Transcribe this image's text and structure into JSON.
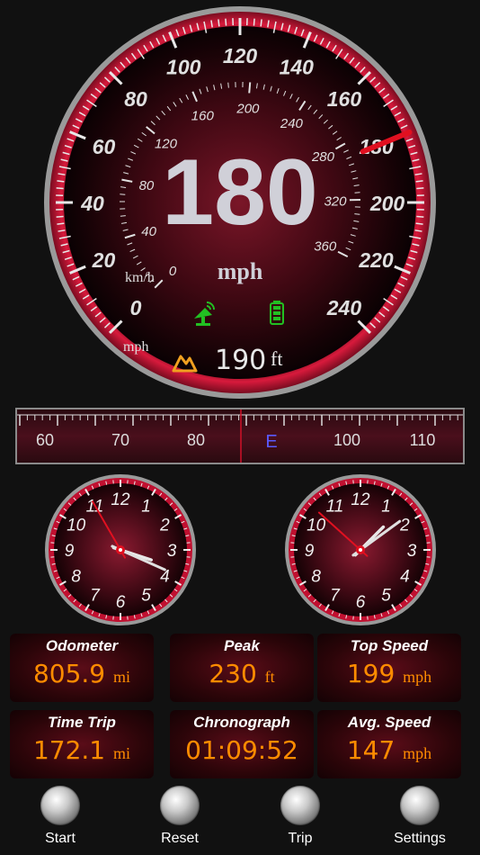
{
  "speedometer": {
    "speed": "180",
    "unit": "mph",
    "needle_value_mph": 180,
    "outer_ticks": [
      "0",
      "20",
      "40",
      "60",
      "80",
      "100",
      "120",
      "140",
      "160",
      "180",
      "200",
      "220",
      "240"
    ],
    "outer_unit": "mph",
    "inner_ticks": [
      "0",
      "40",
      "80",
      "120",
      "160",
      "200",
      "240",
      "280",
      "320",
      "360"
    ],
    "inner_unit": "km/h",
    "altitude_value": "190",
    "altitude_unit": "ft",
    "colors": {
      "accent": "#cc1030",
      "needle": "#e01020",
      "gps": "#22c022",
      "battery": "#22c022",
      "altitude_icon": "#f0a020"
    }
  },
  "compass": {
    "labels": [
      "60",
      "70",
      "80",
      "E",
      "100",
      "110"
    ],
    "heading_label": "E"
  },
  "clocks": [
    {
      "name": "left",
      "numbers": [
        "12",
        "1",
        "2",
        "3",
        "4",
        "5",
        "6",
        "7",
        "8",
        "9",
        "10",
        "11"
      ],
      "hour": 3.6,
      "minute": 19,
      "second": 55
    },
    {
      "name": "right",
      "numbers": [
        "12",
        "1",
        "2",
        "3",
        "4",
        "5",
        "6",
        "7",
        "8",
        "9",
        "10",
        "11"
      ],
      "hour": 1.5,
      "minute": 9,
      "second": 52
    }
  ],
  "cards": [
    {
      "title": "Odometer",
      "value": "805.9",
      "unit": "mi"
    },
    {
      "title": "Peak",
      "value": "230",
      "unit": "ft"
    },
    {
      "title": "Top Speed",
      "value": "199",
      "unit": "mph"
    },
    {
      "title": "Time Trip",
      "value": "172.1",
      "unit": "mi"
    },
    {
      "title": "Chronograph",
      "value": "01:09:52",
      "unit": ""
    },
    {
      "title": "Avg. Speed",
      "value": "147",
      "unit": "mph"
    }
  ],
  "buttons": [
    {
      "label": "Start"
    },
    {
      "label": "Reset"
    },
    {
      "label": "Trip"
    },
    {
      "label": "Settings"
    }
  ]
}
